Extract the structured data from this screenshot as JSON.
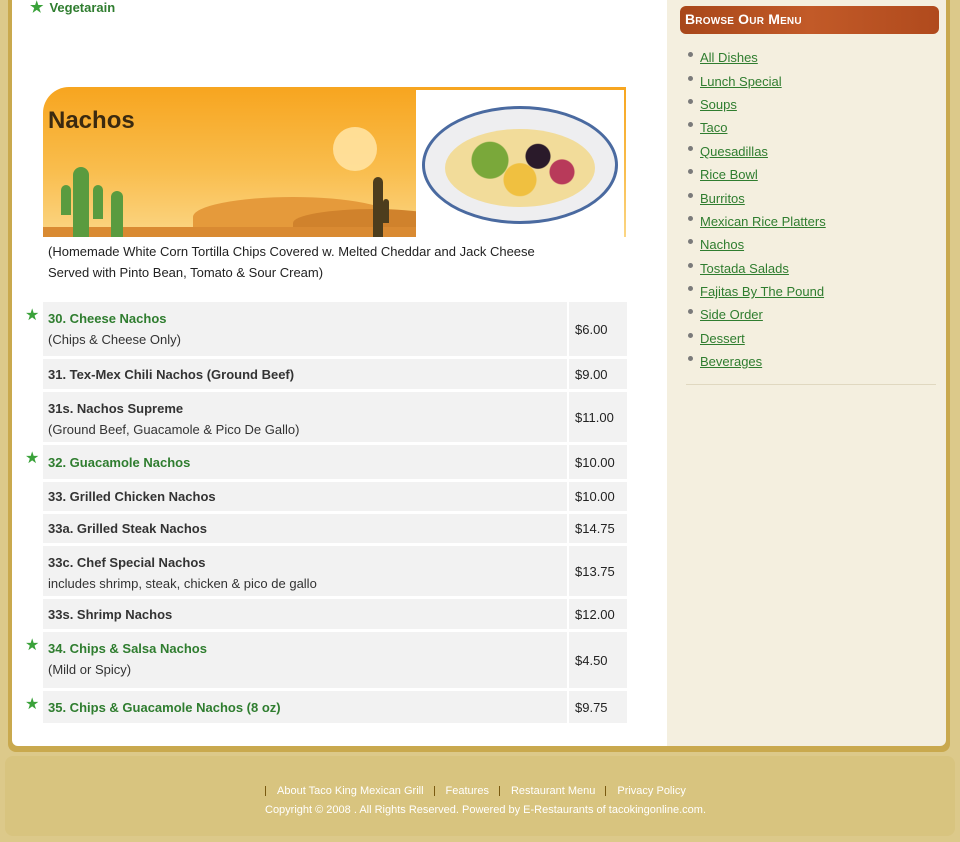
{
  "vegetarian": {
    "label": "Vegetarain"
  },
  "section": {
    "title": "Nachos",
    "description_line1": "(Homemade White Corn Tortilla Chips Covered w. Melted Cheddar and Jack Cheese",
    "description_line2": "Served with Pinto Bean, Tomato & Sour Cream)"
  },
  "items": [
    {
      "name": "30. Cheese Nachos",
      "sub": "(Chips & Cheese Only)",
      "price": "$6.00",
      "special": true
    },
    {
      "name": "31. Tex-Mex Chili Nachos (Ground Beef)",
      "sub": "",
      "price": "$9.00",
      "special": false
    },
    {
      "name": "31s. Nachos Supreme",
      "sub": "(Ground Beef, Guacamole & Pico De Gallo)",
      "price": "$11.00",
      "special": false
    },
    {
      "name": "32. Guacamole Nachos",
      "sub": "",
      "price": "$10.00",
      "special": true
    },
    {
      "name": "33. Grilled Chicken Nachos",
      "sub": "",
      "price": "$10.00",
      "special": false
    },
    {
      "name": "33a. Grilled Steak Nachos",
      "sub": "",
      "price": "$14.75",
      "special": false
    },
    {
      "name": "33c. Chef Special Nachos",
      "sub": "includes shrimp, steak, chicken & pico de gallo",
      "price": "$13.75",
      "special": false
    },
    {
      "name": "33s. Shrimp Nachos",
      "sub": "",
      "price": "$12.00",
      "special": false
    },
    {
      "name": "34. Chips & Salsa Nachos",
      "sub": "(Mild or Spicy)",
      "price": "$4.50",
      "special": true
    },
    {
      "name": "35. Chips & Guacamole Nachos (8 oz)",
      "sub": "",
      "price": "$9.75",
      "special": true
    }
  ],
  "sidebar": {
    "heading": "Browse Our Menu",
    "links": [
      "All Dishes",
      "Lunch Special",
      "Soups",
      "Taco",
      "Quesadillas",
      "Rice Bowl",
      "Burritos",
      "Mexican Rice Platters",
      "Nachos",
      "Tostada Salads",
      "Fajitas By The Pound",
      "Side Order",
      "Dessert",
      "Beverages"
    ]
  },
  "footer": {
    "links": [
      "About Taco King Mexican Grill",
      "Features",
      "Restaurant Menu",
      "Privacy Policy"
    ],
    "copyright": "Copyright © 2008 . All Rights Reserved. Powered by E-Restaurants of tacokingonline.com."
  },
  "colors": {
    "accent_green": "#2f7d2f",
    "header_red": "#b04a1d",
    "banner_orange": "#f7a51f"
  }
}
